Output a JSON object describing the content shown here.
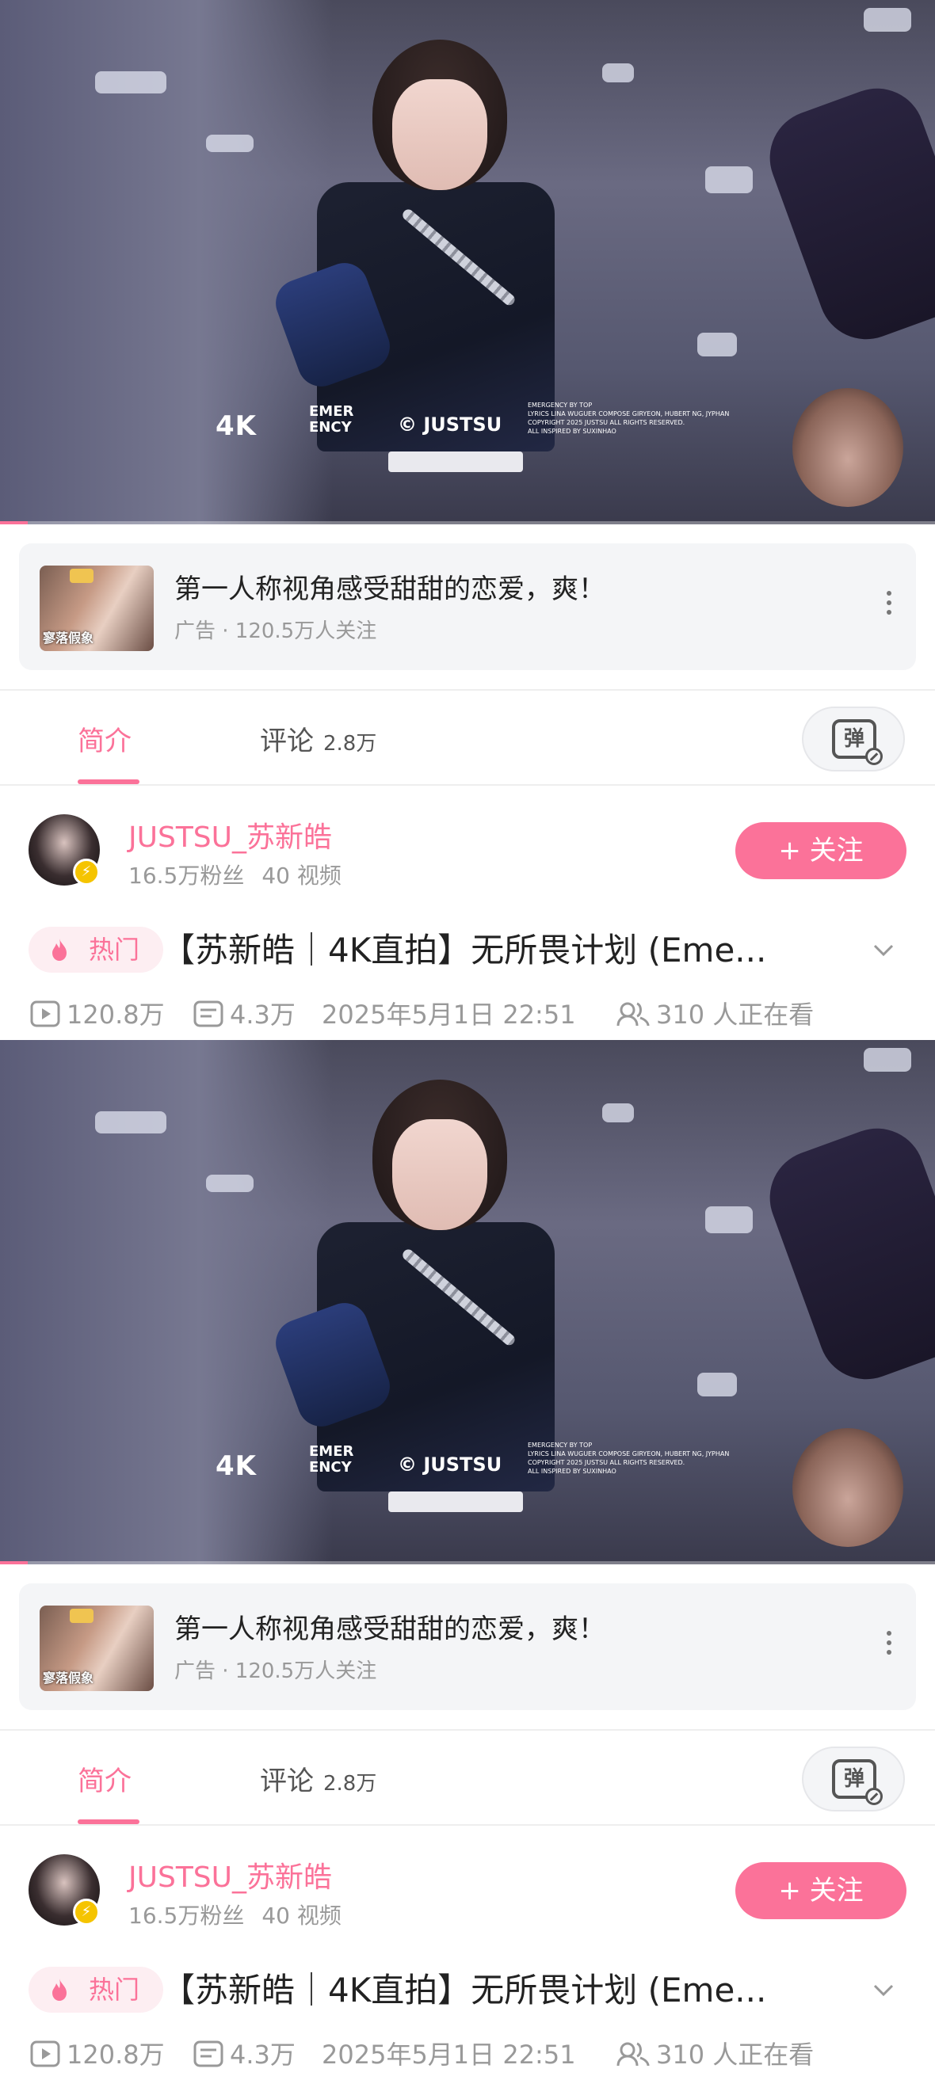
{
  "video": {
    "overlay_quality": "4K",
    "overlay_song": "EMER\nENCY",
    "overlay_logo": "© JUSTSU",
    "overlay_credits": "EMERGENCY BY TOP\nLYRICS LINA WUGUER COMPOSE GIRYEON, HUBERT NG, JYPHAN\nCOPYRIGHT 2025 JUSTSU ALL RIGHTS RESERVED.\nALL INSPIRED BY SUXINHAO",
    "progress_fraction": 0.03
  },
  "ad": {
    "thumb_text": "寥落假象",
    "title": "第一人称视角感受甜甜的恋爱，爽！",
    "meta": "广告 · 120.5万人关注"
  },
  "tabs": {
    "intro": "简介",
    "comments": "评论",
    "comments_count": "2.8万",
    "danmaku_glyph": "弹"
  },
  "uploader": {
    "name": "JUSTSU_苏新皓",
    "fans": "16.5万粉丝",
    "videos": "40 视频",
    "follow_label": "+ 关注"
  },
  "video_info": {
    "hot_label": "热门",
    "title": "【苏新皓｜4K直拍】无所畏计划 (Eme...",
    "plays": "120.8万",
    "danmaku_count": "4.3万",
    "date": "2025年5月1日 22:51",
    "watching": "310 人正在看"
  },
  "colors": {
    "accent": "#fb7299",
    "text_primary": "#222222",
    "text_secondary": "#999999",
    "card_bg": "#f4f5f7"
  }
}
